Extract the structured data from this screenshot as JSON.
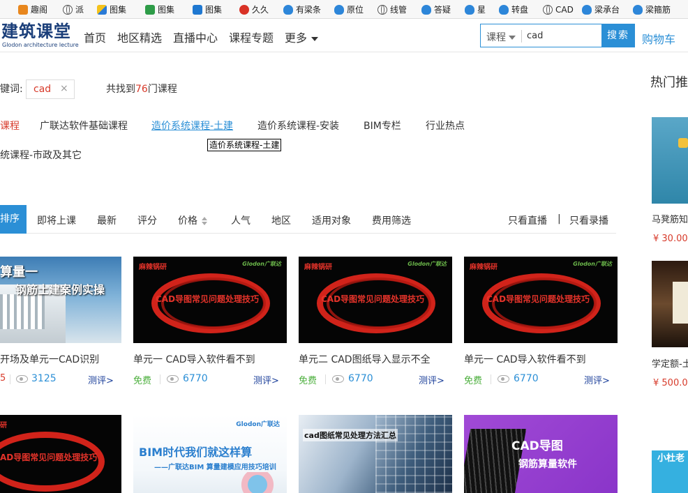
{
  "bookmarks": [
    {
      "label": "趣阁",
      "icon": "orange-tile-icon"
    },
    {
      "label": "派",
      "icon": "globe-icon"
    },
    {
      "label": "图集",
      "icon": "book-icon"
    },
    {
      "label": "图集",
      "icon": "green-tile-icon"
    },
    {
      "label": "图集",
      "icon": "blue-tile-icon"
    },
    {
      "label": "久久",
      "icon": "red-circle-icon"
    },
    {
      "label": "有梁条",
      "icon": "cloud-icon"
    },
    {
      "label": "原位",
      "icon": "cloud-icon"
    },
    {
      "label": "线管",
      "icon": "globe-icon"
    },
    {
      "label": "答疑",
      "icon": "cloud-icon"
    },
    {
      "label": "星",
      "icon": "cloud-icon"
    },
    {
      "label": "转盘",
      "icon": "cloud-icon"
    },
    {
      "label": "CAD",
      "icon": "globe-icon"
    },
    {
      "label": "梁承台",
      "icon": "cloud-icon"
    },
    {
      "label": "梁箍筋",
      "icon": "cloud-icon"
    }
  ],
  "header": {
    "logo_title": "建筑课堂",
    "logo_subtitle": "Glodon architecture lecture",
    "nav": [
      "首页",
      "地区精选",
      "直播中心",
      "课程专题",
      "更多"
    ],
    "search": {
      "category": "课程",
      "value": "cad",
      "button": "搜索"
    },
    "cart": "购物车"
  },
  "keyword": {
    "label": "键词:",
    "tag": "cad",
    "remove": "×",
    "result_prefix": "共找到",
    "result_count": "76",
    "result_suffix": "门课程"
  },
  "categories": {
    "row1": [
      "课程",
      "广联达软件基础课程",
      "造价系统课程-土建",
      "造价系统课程-安装",
      "BIM专栏",
      "行业热点"
    ],
    "row2": [
      "统课程-市政及其它"
    ],
    "tooltip": "造价系统课程-土建"
  },
  "sort": {
    "active": "排序",
    "items": [
      "即将上课",
      "最新",
      "评分",
      "价格",
      "人气",
      "地区",
      "适用对象",
      "费用筛选"
    ],
    "live_only": "只看直播",
    "separator": "|",
    "recorded_only": "只看录播"
  },
  "courses": [
    {
      "title": "开场及单元一CAD识别",
      "price": "5",
      "views": "3125",
      "eval": "测评>",
      "thumb_line1": "算量一",
      "thumb_line2": "钢筋土建案例实操"
    },
    {
      "title": "单元一 CAD导入软件看不到",
      "price": "免费",
      "views": "6770",
      "eval": "测评>",
      "thumb_tl": "麻辣锅研",
      "thumb_text": "CAD导图常见问题处理技巧",
      "thumb_brand": "Glodon广联达"
    },
    {
      "title": "单元二 CAD图纸导入显示不全",
      "price": "免费",
      "views": "6770",
      "eval": "测评>",
      "thumb_tl": "麻辣锅研",
      "thumb_text": "CAD导图常见问题处理技巧",
      "thumb_brand": "Glodon广联达"
    },
    {
      "title": "单元一 CAD导入软件看不到",
      "price": "免费",
      "views": "6770",
      "eval": "测评>",
      "thumb_tl": "麻辣锅研",
      "thumb_text": "CAD导图常见问题处理技巧",
      "thumb_brand": "Glodon广联达"
    }
  ],
  "courses_row2": [
    {
      "thumb_text": "AD导图常见问题处理技巧",
      "thumb_tl": "研"
    },
    {
      "thumb_line1": "BIM时代我们就这样算",
      "thumb_line2": "——广联达BIM 算量建模应用技巧培训",
      "thumb_brand": "Glodon广联达"
    },
    {
      "thumb_line1": "cad图纸常见处理方法汇总"
    },
    {
      "thumb_line1": "CAD导图",
      "thumb_line2": "钢筋算量软件"
    }
  ],
  "hot": {
    "title": "热门推",
    "items": [
      {
        "name": "马凳筋知",
        "price": "¥ 30.00"
      },
      {
        "name": "学定额-土",
        "price": "¥ 500.00"
      },
      {
        "name": "小杜老",
        "price": ""
      }
    ]
  },
  "colors": {
    "accent": "#2b8fd6",
    "highlight": "#d73a2a",
    "free": "#4caf3d",
    "logo": "#1b3f7a"
  }
}
